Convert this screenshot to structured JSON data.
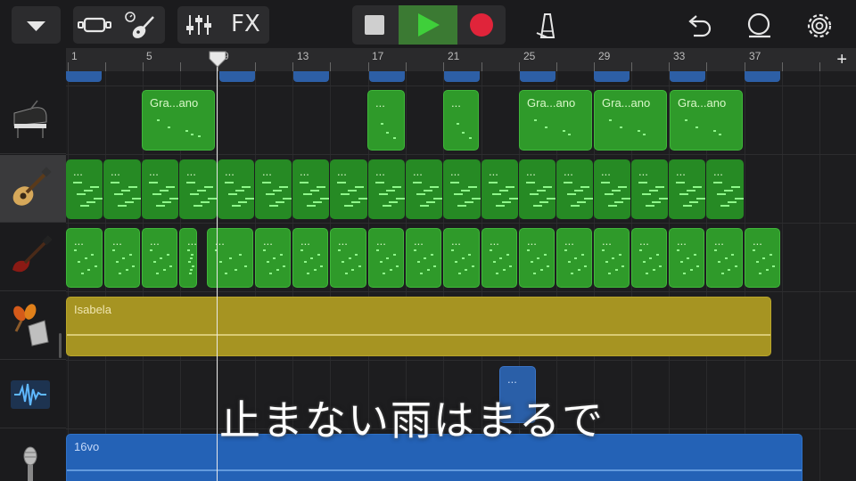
{
  "toolbar": {
    "fx_label": "FX"
  },
  "ruler": {
    "bars": [
      "1",
      "5",
      "9",
      "13",
      "17",
      "21",
      "25",
      "29",
      "33",
      "37"
    ],
    "add_label": "+"
  },
  "tracks": [
    {
      "name": "Grand Piano",
      "icon": "grand-piano-icon"
    },
    {
      "name": "Acoustic Guitar",
      "icon": "acoustic-guitar-icon"
    },
    {
      "name": "Electric Bass",
      "icon": "bass-guitar-icon"
    },
    {
      "name": "Percussion",
      "icon": "percussion-icon"
    },
    {
      "name": "Audio Recorder",
      "icon": "waveform-icon"
    },
    {
      "name": "Vocal",
      "icon": "microphone-icon"
    }
  ],
  "regions": {
    "piano_label": "Gra...ano",
    "ellipsis": "...",
    "percussion_label": "Isabela",
    "vocal_label": "16vo"
  },
  "subtitle": "止まない雨はまるで",
  "colors": {
    "midi_region": "#2f9a2a",
    "audio_region_yellow": "#a69422",
    "audio_region_blue": "#2462b6",
    "record": "#e0243a",
    "play": "#3fcf3a"
  }
}
